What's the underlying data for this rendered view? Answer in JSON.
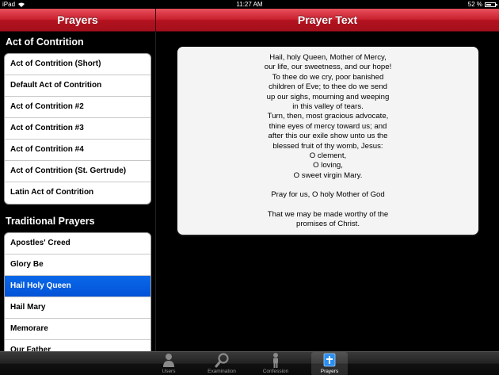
{
  "statusbar": {
    "device": "iPad",
    "time": "11:27 AM",
    "battery": "52 %"
  },
  "nav": {
    "left_title": "Prayers",
    "right_title": "Prayer Text"
  },
  "sections": [
    {
      "title": "Act of Contrition",
      "items": [
        "Act of Contrition (Short)",
        "Default Act of Contrition",
        "Act of Contrition #2",
        "Act of Contrition #3",
        "Act of Contrition #4",
        "Act of Contrition (St. Gertrude)",
        "Latin Act of Contrition"
      ]
    },
    {
      "title": "Traditional Prayers",
      "items": [
        "Apostles' Creed",
        "Glory Be",
        "Hail Holy Queen",
        "Hail Mary",
        "Memorare",
        "Our Father"
      ],
      "selected_index": 2
    }
  ],
  "prayer": {
    "paragraphs": [
      "Hail, holy Queen, Mother of Mercy,\nour life, our sweetness, and our hope!\nTo thee do we cry, poor banished\nchildren of Eve; to thee do we send\nup our sighs, mourning and weeping\nin this valley of tears.\nTurn, then, most gracious advocate,\nthine eyes of mercy toward us; and\nafter this our exile show unto us the\nblessed fruit of thy womb, Jesus:\nO clement,\nO loving,\nO sweet virgin Mary.",
      "Pray for us, O holy Mother of God",
      "That we may be made worthy of the\npromises of Christ."
    ]
  },
  "tabs": [
    {
      "label": "Users",
      "icon": "users-icon"
    },
    {
      "label": "Examination",
      "icon": "magnifier-icon"
    },
    {
      "label": "Confession",
      "icon": "confession-icon"
    },
    {
      "label": "Prayers",
      "icon": "prayer-book-icon"
    }
  ],
  "active_tab": "Prayers",
  "colors": {
    "nav_red": "#c9202e",
    "selection_blue": "#0a68e9",
    "card_bg": "#f4f4f4"
  }
}
